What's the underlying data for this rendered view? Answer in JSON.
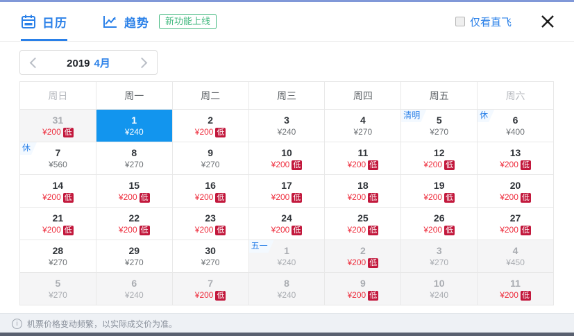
{
  "header": {
    "tabs": [
      {
        "label": "日历",
        "active": true
      },
      {
        "label": "趋势",
        "active": false
      }
    ],
    "new_feature_badge": "新功能上线",
    "direct_only": {
      "label": "仅看直飞",
      "checked": false
    }
  },
  "month_nav": {
    "year": "2019",
    "month": "4月"
  },
  "calendar": {
    "weekday_headers": [
      "周日",
      "周一",
      "周二",
      "周三",
      "周四",
      "周五",
      "周六"
    ],
    "low_badge_label": "低",
    "weeks": [
      [
        {
          "day": "31",
          "price": "¥200",
          "low": true,
          "state": "other"
        },
        {
          "day": "1",
          "price": "¥240",
          "state": "selected"
        },
        {
          "day": "2",
          "price": "¥200",
          "low": true,
          "state": "current"
        },
        {
          "day": "3",
          "price": "¥240",
          "state": "current"
        },
        {
          "day": "4",
          "price": "¥270",
          "state": "current"
        },
        {
          "day": "5",
          "price": "¥270",
          "state": "current",
          "tag": "清明"
        },
        {
          "day": "6",
          "price": "¥400",
          "state": "current",
          "tag": "休"
        }
      ],
      [
        {
          "day": "7",
          "price": "¥560",
          "state": "current",
          "tag": "休"
        },
        {
          "day": "8",
          "price": "¥270",
          "state": "current"
        },
        {
          "day": "9",
          "price": "¥270",
          "state": "current"
        },
        {
          "day": "10",
          "price": "¥200",
          "low": true,
          "state": "current"
        },
        {
          "day": "11",
          "price": "¥200",
          "low": true,
          "state": "current"
        },
        {
          "day": "12",
          "price": "¥200",
          "low": true,
          "state": "current"
        },
        {
          "day": "13",
          "price": "¥200",
          "low": true,
          "state": "current"
        }
      ],
      [
        {
          "day": "14",
          "price": "¥200",
          "low": true,
          "state": "current"
        },
        {
          "day": "15",
          "price": "¥200",
          "low": true,
          "state": "current"
        },
        {
          "day": "16",
          "price": "¥200",
          "low": true,
          "state": "current"
        },
        {
          "day": "17",
          "price": "¥200",
          "low": true,
          "state": "current"
        },
        {
          "day": "18",
          "price": "¥200",
          "low": true,
          "state": "current"
        },
        {
          "day": "19",
          "price": "¥200",
          "low": true,
          "state": "current"
        },
        {
          "day": "20",
          "price": "¥200",
          "low": true,
          "state": "current"
        }
      ],
      [
        {
          "day": "21",
          "price": "¥200",
          "low": true,
          "state": "current"
        },
        {
          "day": "22",
          "price": "¥200",
          "low": true,
          "state": "current"
        },
        {
          "day": "23",
          "price": "¥200",
          "low": true,
          "state": "current"
        },
        {
          "day": "24",
          "price": "¥200",
          "low": true,
          "state": "current"
        },
        {
          "day": "25",
          "price": "¥200",
          "low": true,
          "state": "current"
        },
        {
          "day": "26",
          "price": "¥200",
          "low": true,
          "state": "current"
        },
        {
          "day": "27",
          "price": "¥200",
          "low": true,
          "state": "current"
        }
      ],
      [
        {
          "day": "28",
          "price": "¥270",
          "state": "current"
        },
        {
          "day": "29",
          "price": "¥270",
          "state": "current"
        },
        {
          "day": "30",
          "price": "¥270",
          "state": "current"
        },
        {
          "day": "1",
          "price": "¥240",
          "state": "other",
          "tag": "五一"
        },
        {
          "day": "2",
          "price": "¥200",
          "low": true,
          "state": "other"
        },
        {
          "day": "3",
          "price": "¥270",
          "state": "other"
        },
        {
          "day": "4",
          "price": "¥450",
          "state": "other"
        }
      ],
      [
        {
          "day": "5",
          "price": "¥270",
          "state": "other"
        },
        {
          "day": "6",
          "price": "¥240",
          "state": "other"
        },
        {
          "day": "7",
          "price": "¥200",
          "low": true,
          "state": "other"
        },
        {
          "day": "8",
          "price": "¥240",
          "state": "other"
        },
        {
          "day": "9",
          "price": "¥200",
          "low": true,
          "state": "other"
        },
        {
          "day": "10",
          "price": "¥240",
          "state": "other"
        },
        {
          "day": "11",
          "price": "¥200",
          "low": true,
          "state": "other"
        }
      ]
    ]
  },
  "footer": {
    "tip": "机票价格变动频繁，以实际成交价为准。"
  },
  "colors": {
    "accent_blue": "#2a80e8",
    "selected_day_bg": "#1295ee",
    "price_red": "#ee2c3c",
    "low_badge_bg": "#c2183c",
    "badge_green": "#43b97f",
    "other_month_bg": "#f5f5f6",
    "top_line": "#8098d8",
    "footer_bg": "#eef1f5",
    "bottom_strip": "#59606f"
  }
}
